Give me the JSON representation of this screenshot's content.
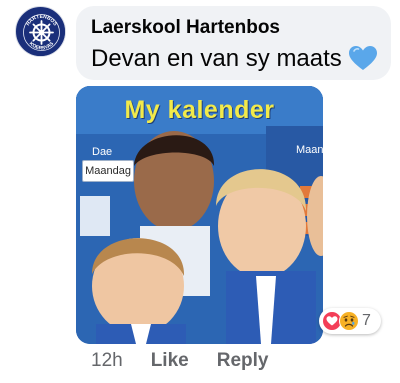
{
  "post": {
    "author": "Laerskool Hartenbos",
    "comment": "Devan en van sy maats",
    "emoji": "blue-heart-icon",
    "avatar_icon": "ship-wheel-icon",
    "avatar_lettering": "HARTENBOS KOERSVAS"
  },
  "photo": {
    "board_title": "My kalender",
    "board_day": "Maandag",
    "board_word_left": "Dae",
    "board_word_right": "Maande"
  },
  "reactions": {
    "icons": [
      "heart-reaction-icon",
      "sad-reaction-icon"
    ],
    "count": "7"
  },
  "actions": {
    "time": "12h",
    "like_label": "Like",
    "reply_label": "Reply"
  },
  "colors": {
    "bubble": "#f0f2f5",
    "meta_text": "#65676b",
    "avatar_bg": "#1a2f7a",
    "heart_red": "#f33e58",
    "sad_yellow": "#f7b125",
    "blue_heart": "#5aa7ea"
  }
}
